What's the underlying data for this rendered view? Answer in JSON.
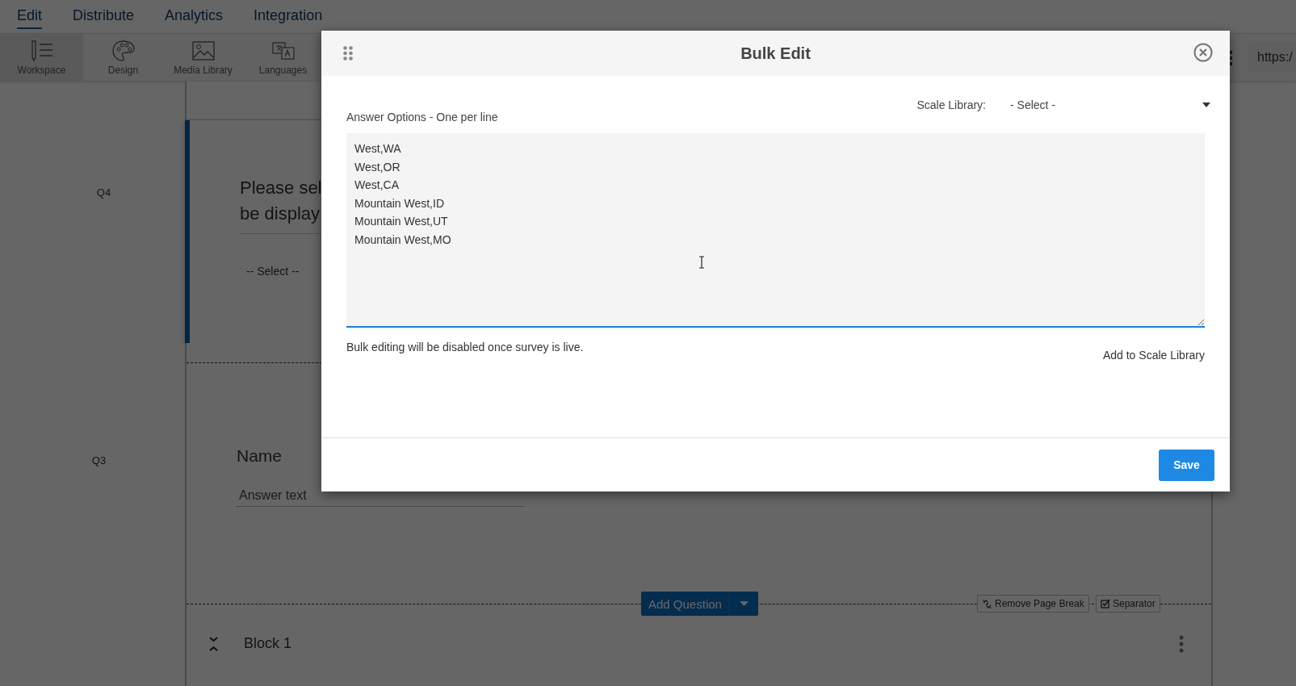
{
  "nav_tabs": [
    {
      "label": "Edit",
      "selected": true
    },
    {
      "label": "Distribute",
      "selected": false
    },
    {
      "label": "Analytics",
      "selected": false
    },
    {
      "label": "Integration",
      "selected": false
    }
  ],
  "toolbar": {
    "items": [
      {
        "label": "Workspace",
        "kind": "workspace",
        "selected": true
      },
      {
        "label": "Design",
        "kind": "design",
        "selected": false
      },
      {
        "label": "Media Library",
        "kind": "media",
        "selected": false
      },
      {
        "label": "Languages",
        "kind": "languages",
        "selected": false
      }
    ],
    "url_field": "https:/"
  },
  "questions": [
    {
      "number": "Q4",
      "kind": "dropdown",
      "active": true,
      "text_lines": [
        "Please sel",
        "be display"
      ],
      "select_placeholder": "-- Select --"
    },
    {
      "number": "Q3",
      "kind": "text",
      "active": false,
      "title": "Name",
      "placeholder": "Answer text"
    }
  ],
  "page_break": {
    "add_question": "Add Question",
    "remove_page_break": "Remove Page Break",
    "separator": "Separator"
  },
  "block": {
    "title": "Block 1"
  },
  "modal": {
    "title": "Bulk Edit",
    "answer_options_label": "Answer Options - One per line",
    "scale_library_label": "Scale Library:",
    "scale_library_select": "- Select -",
    "answer_options": [
      "West,WA",
      "West,OR",
      "West,CA",
      "Mountain West,ID",
      "Mountain West,UT",
      "Mountain West,MO"
    ],
    "note": "Bulk editing will be disabled once survey is live.",
    "add_to_scale_library": "Add to Scale Library",
    "save": "Save"
  }
}
